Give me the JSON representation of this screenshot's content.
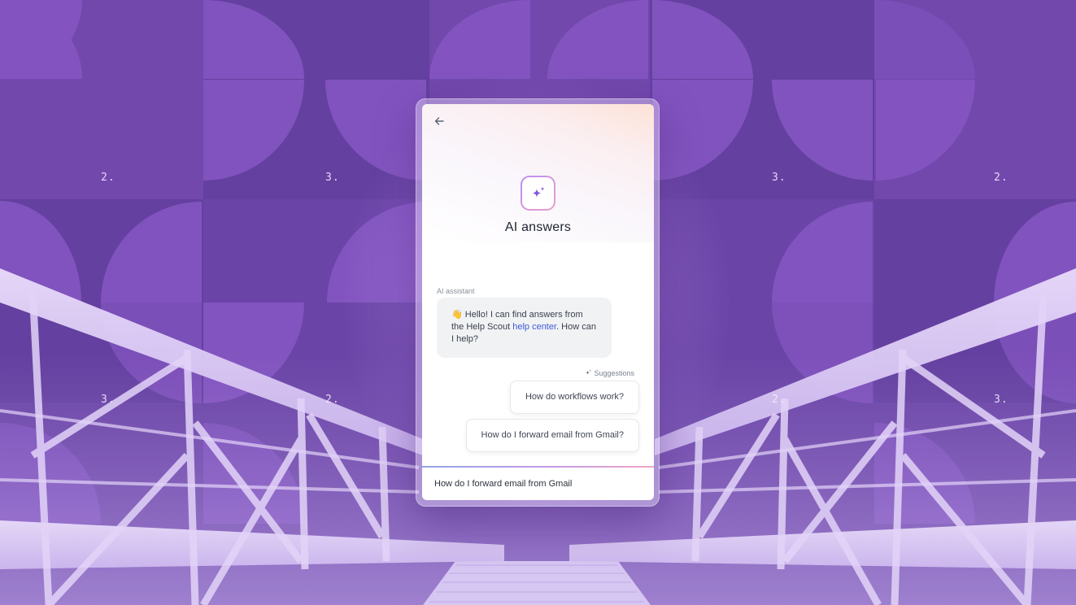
{
  "background": {
    "markers": [
      "2.",
      "3.",
      "3.",
      "2.",
      "3.",
      "2.",
      "2.",
      "3."
    ]
  },
  "widget": {
    "back_icon": "arrow-left-icon",
    "badge_icon": "sparkles-icon",
    "title": "AI answers",
    "sender_label": "AI assistant",
    "message": {
      "wave_emoji": "👋",
      "before_link": " Hello! I can find answers from the Help Scout ",
      "link_text": "help center",
      "after_link": ". How can I help?"
    },
    "suggestions_label": "Suggestions",
    "suggestions": [
      "How do workflows work?",
      "How do I forward email from Gmail?"
    ],
    "input": {
      "value": "How do I forward email from Gmail",
      "placeholder": ""
    }
  },
  "colors": {
    "background": "#6a44a6",
    "link": "#3f5bd6",
    "badge_gradient_start": "#b68ef4",
    "badge_gradient_end": "#ef9fc7"
  }
}
